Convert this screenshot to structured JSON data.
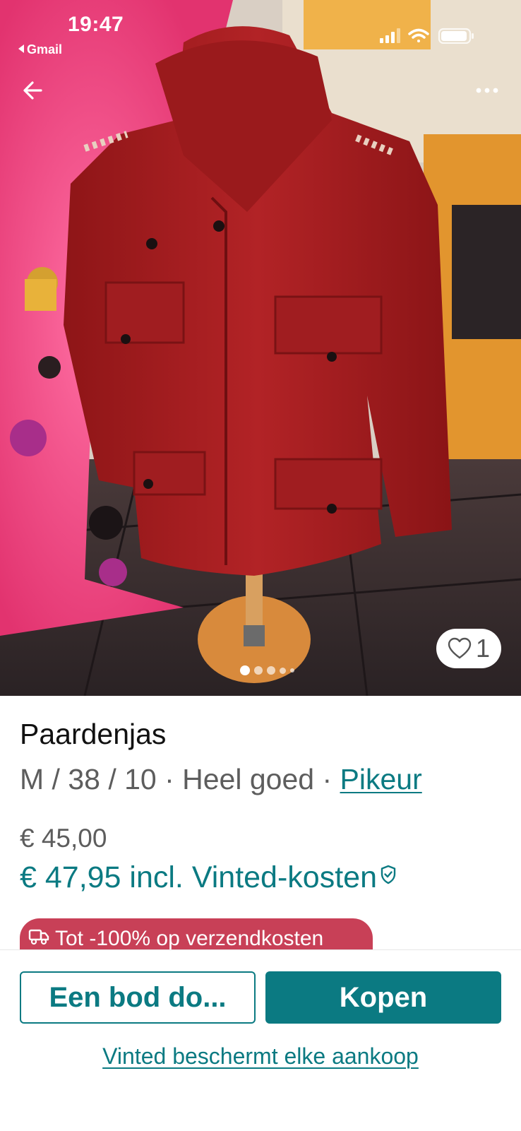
{
  "status_bar": {
    "time": "19:47",
    "back_app": "Gmail"
  },
  "icons": {
    "back": "arrow-left-icon",
    "more": "more-horizontal-icon",
    "favorite": "heart-icon",
    "shield": "shield-check-icon",
    "truck": "truck-icon"
  },
  "gallery": {
    "photo_count": 5,
    "active_index": 0,
    "favorites_count": "1"
  },
  "item": {
    "title": "Paardenjas",
    "details": "M / 38 / 10 · Heel goed · ",
    "brand": "Pikeur",
    "price": "€ 45,00",
    "price_total": "€ 47,95 incl. Vinted-kosten"
  },
  "promo": {
    "label": "Tot -100% op verzendkosten"
  },
  "actions": {
    "offer_label": "Een bod do...",
    "buy_label": "Kopen",
    "protection_link": "Vinted beschermt elke aankoop"
  },
  "colors": {
    "accent": "#0b7a82",
    "promo": "#c84057",
    "jacket": "#a81d1f"
  }
}
